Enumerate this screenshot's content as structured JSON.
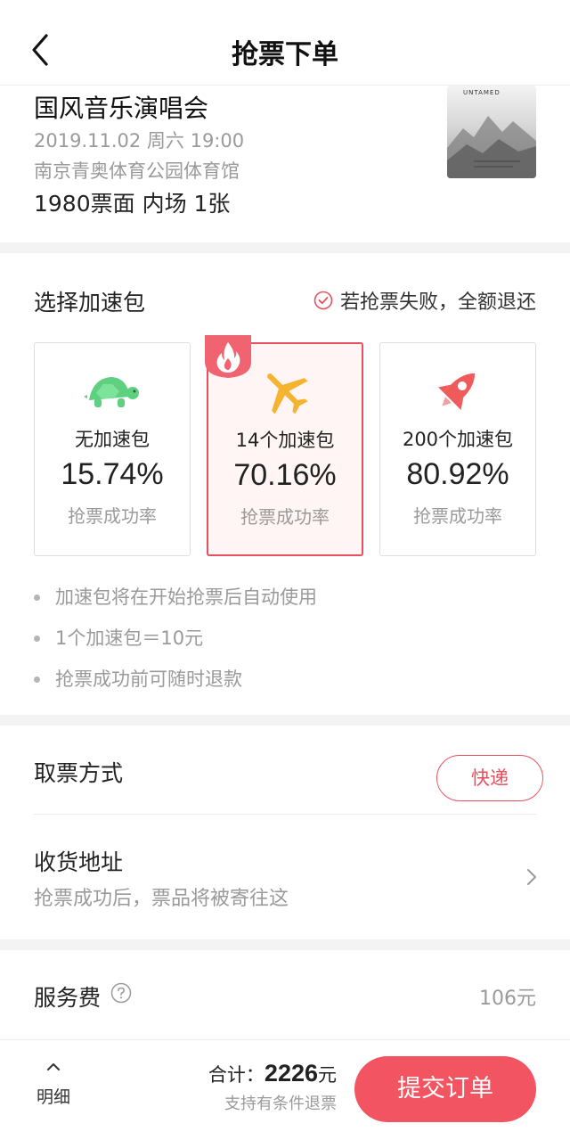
{
  "header": {
    "title": "抢票下单",
    "back_icon": "back-arrow-icon"
  },
  "event": {
    "name": "国风音乐演唱会",
    "datetime": "2019.11.02 周六 19:00",
    "venue": "南京青奥体育公园体育馆",
    "ticket_info": "1980票面 内场 1张",
    "poster_title": "UNTAMED"
  },
  "boost": {
    "title": "选择加速包",
    "guarantee": "若抢票失败，全额退还",
    "options": [
      {
        "icon": "turtle-icon",
        "label": "无加速包",
        "rate": "15.74%",
        "rate_label": "抢票成功率",
        "selected": false
      },
      {
        "icon": "airplane-icon",
        "label": "14个加速包",
        "rate": "70.16%",
        "rate_label": "抢票成功率",
        "selected": true
      },
      {
        "icon": "rocket-icon",
        "label": "200个加速包",
        "rate": "80.92%",
        "rate_label": "抢票成功率",
        "selected": false
      }
    ],
    "notes": [
      "加速包将在开始抢票后自动使用",
      "1个加速包＝10元",
      "抢票成功前可随时退款"
    ]
  },
  "delivery": {
    "label": "取票方式",
    "method": "快递"
  },
  "address": {
    "label": "收货地址",
    "hint": "抢票成功后，票品将被寄往这"
  },
  "service_fee": {
    "label": "服务费",
    "value": "106元"
  },
  "footer": {
    "detail_label": "明细",
    "total_prefix": "合计：",
    "total_amount": "2226",
    "total_unit": "元",
    "refund_note": "支持有条件退票",
    "submit_label": "提交订单"
  },
  "colors": {
    "accent": "#e8505d",
    "submit": "#f25561",
    "turtle": "#5fcf80",
    "plane": "#f5b330",
    "rocket": "#ef5b5b"
  }
}
